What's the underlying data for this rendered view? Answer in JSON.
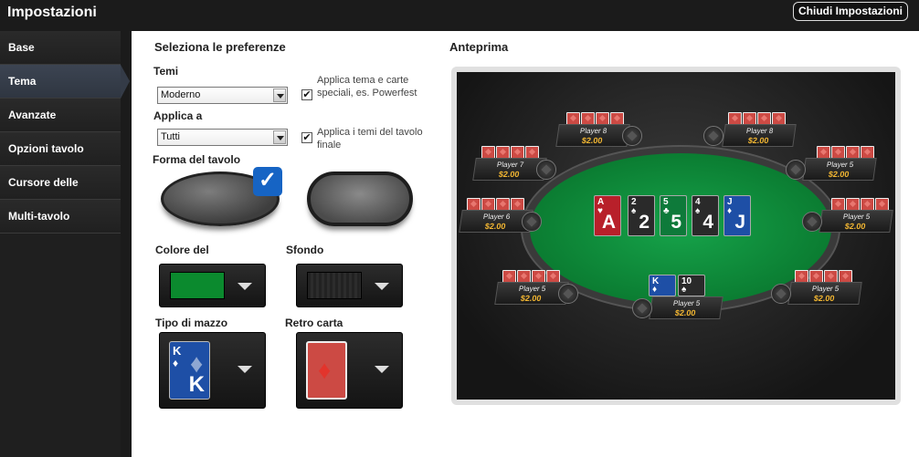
{
  "header": {
    "title": "Impostazioni",
    "close_label": "Chiudi Impostazioni"
  },
  "sidebar": {
    "items": [
      {
        "label": "Base"
      },
      {
        "label": "Tema",
        "active": true
      },
      {
        "label": "Avanzate"
      },
      {
        "label": "Opzioni tavolo"
      },
      {
        "label": "Cursore delle puntate"
      },
      {
        "label": "Multi-tavolo"
      }
    ]
  },
  "preferences": {
    "title": "Seleziona le preferenze",
    "temi_label": "Temi",
    "temi_value": "Moderno",
    "applica_label": "Applica a",
    "applica_value": "Tutti",
    "check1_text": "Applica tema e carte speciali, es. Powerfest",
    "check2_text": "Applica i temi del tavolo finale",
    "check1_checked": true,
    "check2_checked": true,
    "shape_label": "Forma del tavolo",
    "selected_shape": "oval",
    "colore_label": "Colore del",
    "colore_value": "#0b8a2e",
    "sfondo_label": "Sfondo",
    "mazzo_label": "Tipo di mazzo",
    "retro_label": "Retro carta"
  },
  "preview": {
    "title": "Anteprima",
    "seats": [
      {
        "name": "Player 8",
        "stack": "$2.00"
      },
      {
        "name": "Player 8",
        "stack": "$2.00"
      },
      {
        "name": "Player 7",
        "stack": "$2.00"
      },
      {
        "name": "Player 5",
        "stack": "$2.00"
      },
      {
        "name": "Player 6",
        "stack": "$2.00"
      },
      {
        "name": "Player 5",
        "stack": "$2.00"
      },
      {
        "name": "Player 5",
        "stack": "$2.00"
      },
      {
        "name": "Player 5",
        "stack": "$2.00"
      },
      {
        "name": "Player 5",
        "stack": "$2.00"
      }
    ],
    "board": [
      {
        "rank": "A",
        "suit": "♥",
        "color": "#b8202a"
      },
      {
        "rank": "2",
        "suit": "♠",
        "color": "#2a2a2a"
      },
      {
        "rank": "5",
        "suit": "♣",
        "color": "#0e7a3a"
      },
      {
        "rank": "4",
        "suit": "♠",
        "color": "#2a2a2a"
      },
      {
        "rank": "J",
        "suit": "♦",
        "color": "#1e4fa6"
      }
    ],
    "hero_cards": [
      {
        "rank": "K",
        "suit": "♦",
        "color": "#1e4fa6"
      },
      {
        "rank": "10",
        "suit": "♠",
        "color": "#2a2a2a"
      }
    ]
  },
  "deck_card": {
    "rank": "K",
    "suit": "♦"
  },
  "colors": {
    "felt": "#0b8a2e",
    "accent": "#1664c4",
    "stack": "#f2b632",
    "card_back": "#cc4a44"
  }
}
